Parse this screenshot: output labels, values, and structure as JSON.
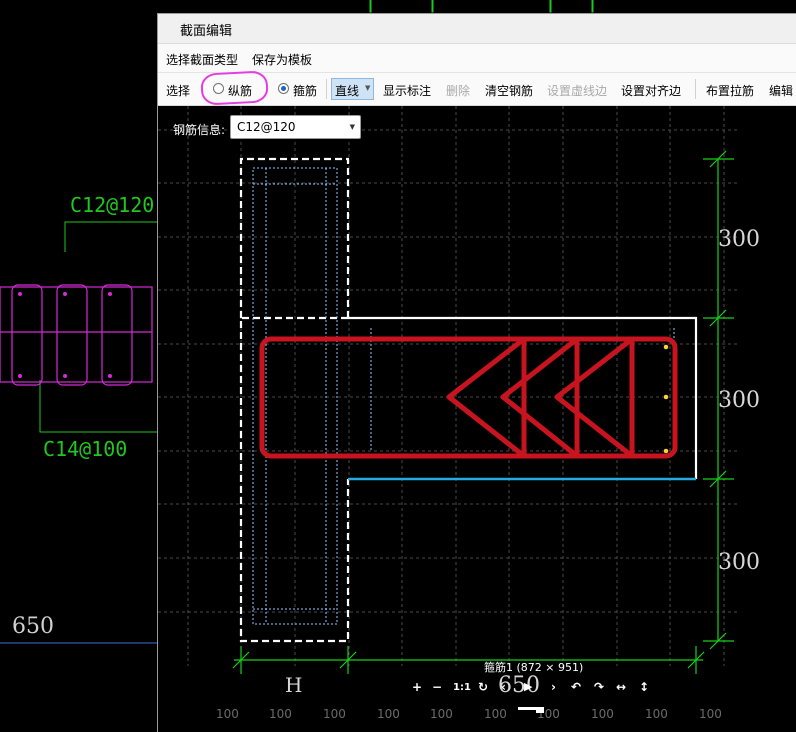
{
  "background": {
    "top_label": "C12@120",
    "bottom_label": "C14@100",
    "dim_label": "650"
  },
  "dialog": {
    "title": "截面编辑",
    "menu": {
      "select_section_type": "选择截面类型",
      "save_as_template": "保存为模板"
    },
    "toolbar": {
      "select": "选择",
      "longitudinal": "纵筋",
      "stirrup": "箍筋",
      "mode": "直线",
      "show_labels": "显示标注",
      "delete": "删除",
      "clear_rebar": "清空钢筋",
      "set_virtual_edge": "设置虚线边",
      "set_align_edge": "设置对齐边",
      "place_tie": "布置拉筋",
      "edit_cut": "编辑"
    },
    "rebar_info": {
      "label": "钢筋信息:",
      "value": "C12@120"
    }
  },
  "canvas": {
    "dims_right": [
      "300",
      "300",
      "300"
    ],
    "dim_bottom": "650",
    "h_label": "H",
    "grid_labels": [
      "100",
      "100",
      "100",
      "100",
      "100",
      "100",
      "100",
      "100",
      "100",
      "100"
    ],
    "status_text": "箍筋1 (872 × 951)"
  },
  "nav": {
    "zoom_in": "+",
    "zoom_out": "−",
    "one_to_one": "1:1",
    "refresh": "↻",
    "prev": "‹",
    "play": "▶",
    "next": "›",
    "undo": "↶",
    "redo": "↷",
    "fit_width": "↔",
    "fit_height": "↕"
  },
  "colors": {
    "stirrup_red": "#c8141e",
    "section_white": "#ffffff",
    "edge_blue": "#2aa8e0",
    "dim_green": "#18d018",
    "bg_magenta": "#d52ad5",
    "highlight_ring": "#e53de0"
  }
}
